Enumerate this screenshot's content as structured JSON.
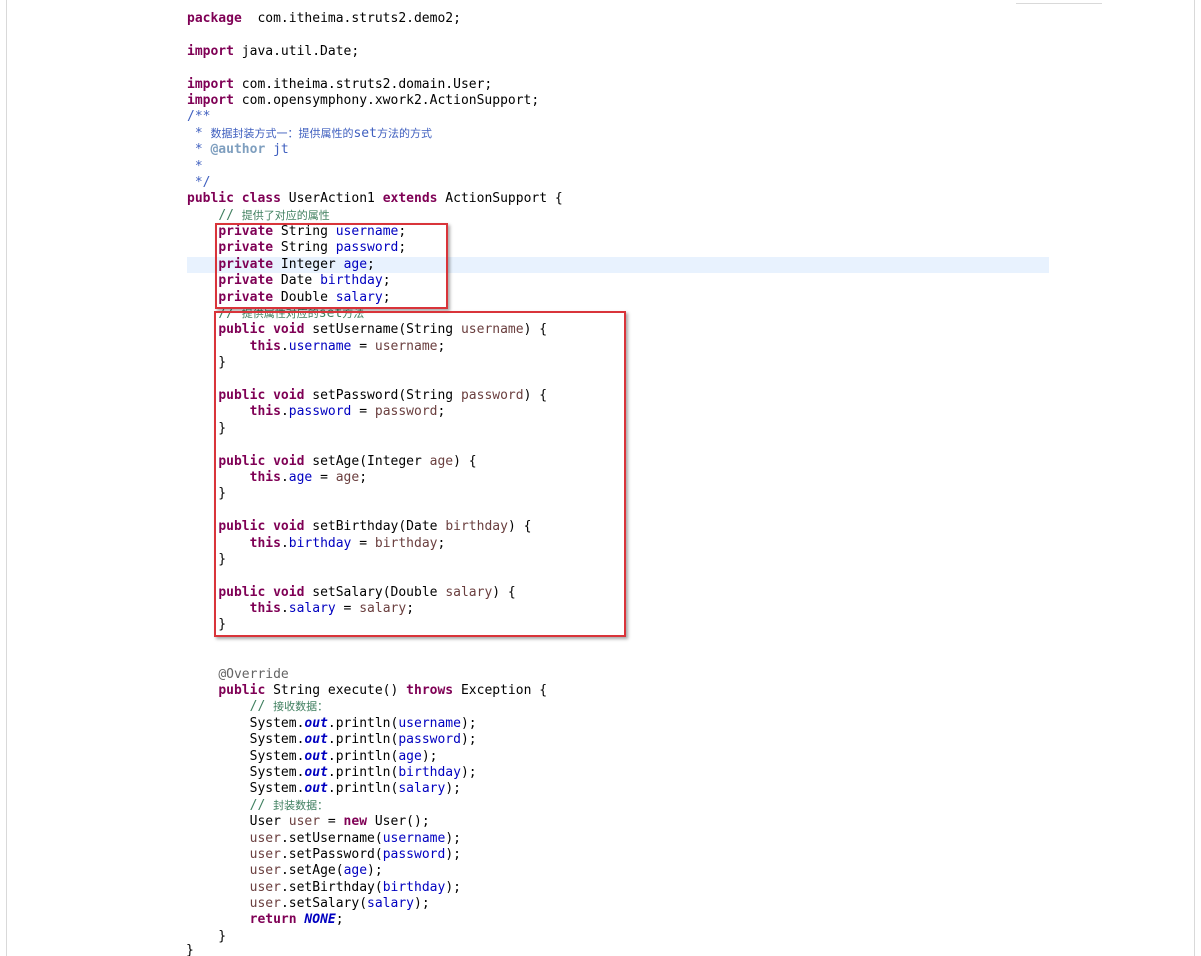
{
  "document": {
    "lines": [
      [
        [
          "kw",
          "package"
        ],
        [
          "",
          "  com.itheima.struts2.demo2;"
        ]
      ],
      [],
      [
        [
          "kw",
          "import"
        ],
        [
          "",
          " java.util.Date;"
        ]
      ],
      [],
      [
        [
          "kw",
          "import"
        ],
        [
          "",
          " com.itheima.struts2.domain.User;"
        ]
      ],
      [
        [
          "kw",
          "import"
        ],
        [
          "",
          " com.opensymphony.xwork2.ActionSupport;"
        ]
      ],
      [
        [
          "jd",
          "/**"
        ]
      ],
      [
        [
          "jd",
          " * "
        ],
        [
          "jd cn",
          "数据封装方式一：提供属性的"
        ],
        [
          "jd",
          "set"
        ],
        [
          "jd cn",
          "方法的方式"
        ]
      ],
      [
        [
          "jd",
          " * "
        ],
        [
          "jt",
          "@author"
        ],
        [
          "jd",
          " jt"
        ]
      ],
      [
        [
          "jd",
          " *"
        ]
      ],
      [
        [
          "jd",
          " */"
        ]
      ],
      [
        [
          "kw",
          "public"
        ],
        [
          "",
          "",
          " "
        ],
        [
          "kw",
          "class"
        ],
        [
          "",
          " UserAction1 "
        ],
        [
          "kw",
          "extends"
        ],
        [
          "",
          " ActionSupport {"
        ]
      ],
      [
        [
          "",
          "    "
        ],
        [
          "cm",
          "// "
        ],
        [
          "cm cn",
          "提供了对应的属性"
        ]
      ],
      [
        [
          "",
          "    "
        ],
        [
          "kw",
          "private"
        ],
        [
          "",
          " String "
        ],
        [
          "fld",
          "username"
        ],
        [
          "",
          ";"
        ]
      ],
      [
        [
          "",
          "    "
        ],
        [
          "kw",
          "private"
        ],
        [
          "",
          " String "
        ],
        [
          "fld",
          "password"
        ],
        [
          "",
          ";"
        ]
      ],
      [
        [
          "",
          "    "
        ],
        [
          "kw",
          "private"
        ],
        [
          "",
          " Integer "
        ],
        [
          "fld",
          "age"
        ],
        [
          "",
          ";"
        ]
      ],
      [
        [
          "",
          "    "
        ],
        [
          "kw",
          "private"
        ],
        [
          "",
          " Date "
        ],
        [
          "fld",
          "birthday"
        ],
        [
          "",
          ";"
        ]
      ],
      [
        [
          "",
          "    "
        ],
        [
          "kw",
          "private"
        ],
        [
          "",
          " Double "
        ],
        [
          "fld",
          "salary"
        ],
        [
          "",
          ";"
        ]
      ],
      [
        [
          "",
          "    "
        ],
        [
          "cm",
          "// "
        ],
        [
          "cm cn",
          "提供属性对应的"
        ],
        [
          "cm",
          "set"
        ],
        [
          "cm cn",
          "方法"
        ]
      ],
      [
        [
          "",
          "    "
        ],
        [
          "kw",
          "public"
        ],
        [
          "",
          "",
          " "
        ],
        [
          "kw",
          "void"
        ],
        [
          "",
          " setUsername(String "
        ],
        [
          "par",
          "username"
        ],
        [
          "",
          ") {"
        ]
      ],
      [
        [
          "",
          "        "
        ],
        [
          "kw",
          "this"
        ],
        [
          "",
          "."
        ],
        [
          "fld",
          "username"
        ],
        [
          "",
          " = "
        ],
        [
          "par",
          "username"
        ],
        [
          "",
          ";"
        ]
      ],
      [
        [
          "",
          "    }"
        ]
      ],
      [],
      [
        [
          "",
          "    "
        ],
        [
          "kw",
          "public"
        ],
        [
          "",
          "",
          " "
        ],
        [
          "kw",
          "void"
        ],
        [
          "",
          " setPassword(String "
        ],
        [
          "par",
          "password"
        ],
        [
          "",
          ") {"
        ]
      ],
      [
        [
          "",
          "        "
        ],
        [
          "kw",
          "this"
        ],
        [
          "",
          "."
        ],
        [
          "fld",
          "password"
        ],
        [
          "",
          " = "
        ],
        [
          "par",
          "password"
        ],
        [
          "",
          ";"
        ]
      ],
      [
        [
          "",
          "    }"
        ]
      ],
      [],
      [
        [
          "",
          "    "
        ],
        [
          "kw",
          "public"
        ],
        [
          "",
          "",
          " "
        ],
        [
          "kw",
          "void"
        ],
        [
          "",
          " setAge(Integer "
        ],
        [
          "par",
          "age"
        ],
        [
          "",
          ") {"
        ]
      ],
      [
        [
          "",
          "        "
        ],
        [
          "kw",
          "this"
        ],
        [
          "",
          "."
        ],
        [
          "fld",
          "age"
        ],
        [
          "",
          " = "
        ],
        [
          "par",
          "age"
        ],
        [
          "",
          ";"
        ]
      ],
      [
        [
          "",
          "    }"
        ]
      ],
      [],
      [
        [
          "",
          "    "
        ],
        [
          "kw",
          "public"
        ],
        [
          "",
          "",
          " "
        ],
        [
          "kw",
          "void"
        ],
        [
          "",
          " setBirthday(Date "
        ],
        [
          "par",
          "birthday"
        ],
        [
          "",
          ") {"
        ]
      ],
      [
        [
          "",
          "        "
        ],
        [
          "kw",
          "this"
        ],
        [
          "",
          "."
        ],
        [
          "fld",
          "birthday"
        ],
        [
          "",
          " = "
        ],
        [
          "par",
          "birthday"
        ],
        [
          "",
          ";"
        ]
      ],
      [
        [
          "",
          "    }"
        ]
      ],
      [],
      [
        [
          "",
          "    "
        ],
        [
          "kw",
          "public"
        ],
        [
          "",
          "",
          " "
        ],
        [
          "kw",
          "void"
        ],
        [
          "",
          " setSalary(Double "
        ],
        [
          "par",
          "salary"
        ],
        [
          "",
          ") {"
        ]
      ],
      [
        [
          "",
          "        "
        ],
        [
          "kw",
          "this"
        ],
        [
          "",
          "."
        ],
        [
          "fld",
          "salary"
        ],
        [
          "",
          " = "
        ],
        [
          "par",
          "salary"
        ],
        [
          "",
          ";"
        ]
      ],
      [
        [
          "",
          "    }"
        ]
      ],
      [],
      [],
      [
        [
          "",
          "    "
        ],
        [
          "an",
          "@Override"
        ]
      ],
      [
        [
          "",
          "    "
        ],
        [
          "kw",
          "public"
        ],
        [
          "",
          " String execute() "
        ],
        [
          "kw",
          "throws"
        ],
        [
          "",
          " Exception {"
        ]
      ],
      [
        [
          "",
          "        "
        ],
        [
          "cm",
          "// "
        ],
        [
          "cm cn",
          "接收数据："
        ]
      ],
      [
        [
          "",
          "        System."
        ],
        [
          "st",
          "out"
        ],
        [
          "",
          ".println("
        ],
        [
          "fld",
          "username"
        ],
        [
          "",
          ");"
        ]
      ],
      [
        [
          "",
          "        System."
        ],
        [
          "st",
          "out"
        ],
        [
          "",
          ".println("
        ],
        [
          "fld",
          "password"
        ],
        [
          "",
          ");"
        ]
      ],
      [
        [
          "",
          "        System."
        ],
        [
          "st",
          "out"
        ],
        [
          "",
          ".println("
        ],
        [
          "fld",
          "age"
        ],
        [
          "",
          ");"
        ]
      ],
      [
        [
          "",
          "        System."
        ],
        [
          "st",
          "out"
        ],
        [
          "",
          ".println("
        ],
        [
          "fld",
          "birthday"
        ],
        [
          "",
          ");"
        ]
      ],
      [
        [
          "",
          "        System."
        ],
        [
          "st",
          "out"
        ],
        [
          "",
          ".println("
        ],
        [
          "fld",
          "salary"
        ],
        [
          "",
          ");"
        ]
      ],
      [
        [
          "",
          "        "
        ],
        [
          "cm",
          "// "
        ],
        [
          "cm cn",
          "封装数据："
        ]
      ],
      [
        [
          "",
          "        User "
        ],
        [
          "par",
          "user"
        ],
        [
          "",
          " = "
        ],
        [
          "kw",
          "new"
        ],
        [
          "",
          " User();"
        ]
      ],
      [
        [
          "",
          "        "
        ],
        [
          "par",
          "user"
        ],
        [
          "",
          ".setUsername("
        ],
        [
          "fld",
          "username"
        ],
        [
          "",
          ");"
        ]
      ],
      [
        [
          "",
          "        "
        ],
        [
          "par",
          "user"
        ],
        [
          "",
          ".setPassword("
        ],
        [
          "fld",
          "password"
        ],
        [
          "",
          ");"
        ]
      ],
      [
        [
          "",
          "        "
        ],
        [
          "par",
          "user"
        ],
        [
          "",
          ".setAge("
        ],
        [
          "fld",
          "age"
        ],
        [
          "",
          ");"
        ]
      ],
      [
        [
          "",
          "        "
        ],
        [
          "par",
          "user"
        ],
        [
          "",
          ".setBirthday("
        ],
        [
          "fld",
          "birthday"
        ],
        [
          "",
          ");"
        ]
      ],
      [
        [
          "",
          "        "
        ],
        [
          "par",
          "user"
        ],
        [
          "",
          ".setSalary("
        ],
        [
          "fld",
          "salary"
        ],
        [
          "",
          ");"
        ]
      ],
      [
        [
          "",
          "        "
        ],
        [
          "kw",
          "return"
        ],
        [
          "",
          " "
        ],
        [
          "st",
          "NONE"
        ],
        [
          "",
          ";"
        ]
      ],
      [
        [
          "",
          "    }"
        ]
      ]
    ],
    "trailing_brace": "}"
  },
  "annotations": {
    "box_color": "#d9343a",
    "highlight_color": "#e8f2fe"
  },
  "syntax_colors": {
    "keyword": "#7f0055",
    "comment": "#3f7f5f",
    "javadoc": "#3f5fbf",
    "field": "#0000c0",
    "parameter": "#6a3e3e",
    "annotation": "#646464"
  }
}
